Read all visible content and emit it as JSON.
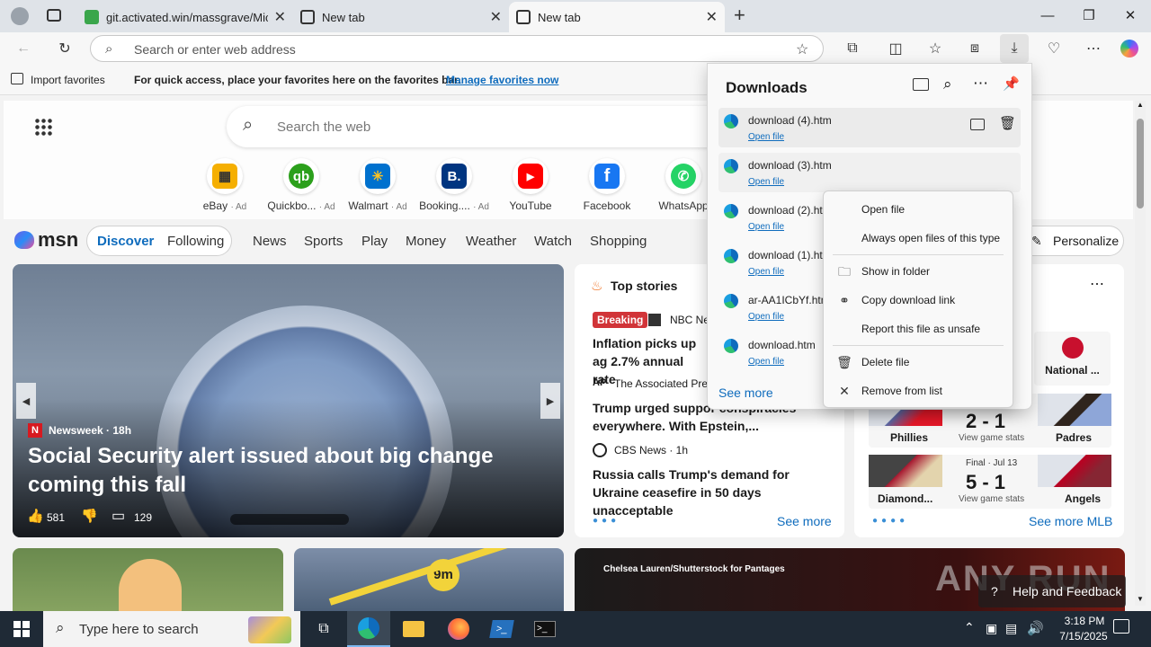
{
  "browser": {
    "tabs": [
      {
        "title": "git.activated.win/massgrave/Micr"
      },
      {
        "title": "New tab"
      },
      {
        "title": "New tab"
      }
    ],
    "address_placeholder": "Search or enter web address"
  },
  "favorites_bar": {
    "import": "Import favorites",
    "message": "For quick access, place your favorites here on the favorites bar.",
    "manage_link": "Manage favorites now"
  },
  "msn": {
    "search_placeholder": "Search the web",
    "quick_links": [
      {
        "label": "eBay",
        "ad": "· Ad"
      },
      {
        "label": "Quickbo...",
        "ad": "· Ad"
      },
      {
        "label": "Walmart",
        "ad": "· Ad"
      },
      {
        "label": "Booking....",
        "ad": "· Ad"
      },
      {
        "label": "YouTube",
        "ad": ""
      },
      {
        "label": "Facebook",
        "ad": ""
      },
      {
        "label": "WhatsApp",
        "ad": ""
      }
    ],
    "logo": "msn",
    "nav": [
      "Discover",
      "Following",
      "News",
      "Sports",
      "Play",
      "Money",
      "Weather",
      "Watch",
      "Shopping"
    ],
    "personalize": "Personalize",
    "hero": {
      "source": "Newsweek · 18h",
      "headline": "Social Security alert issued about big change coming this fall",
      "likes": "581",
      "comments": "129"
    },
    "top_stories": {
      "title": "Top stories",
      "breaking": "Breaking",
      "items": [
        {
          "source": "NBC Ne",
          "headline": "Inflation picks up ag 2.7% annual rate"
        },
        {
          "source": "The Associated Pres",
          "headline": "Trump urged suppor conspiracies everywhere. With Epstein,..."
        },
        {
          "source": "CBS News · 1h",
          "headline": "Russia calls Trump's demand for Ukraine ceasefire in 50 days unacceptable"
        }
      ],
      "see_more": "See more"
    },
    "sports": {
      "national": "National ...",
      "games": [
        {
          "team1": "Phillies",
          "score": "2 - 1",
          "team2": "Padres",
          "status": "View game stats",
          "final": ""
        },
        {
          "team1": "Diamond...",
          "score": "5 - 1",
          "team2": "Angels",
          "status": "View game stats",
          "final": "Final · Jul 13"
        }
      ],
      "see_more": "See more MLB"
    },
    "photo_credit": "Chelsea Lauren/Shutterstock for Pantages",
    "badge_9m": "9m",
    "help": "Help and Feedback"
  },
  "downloads": {
    "title": "Downloads",
    "items": [
      {
        "name": "download (4).htm",
        "open": "Open file"
      },
      {
        "name": "download (3).htm",
        "open": "Open file"
      },
      {
        "name": "download (2).ht",
        "open": "Open file"
      },
      {
        "name": "download (1).ht",
        "open": "Open file"
      },
      {
        "name": "ar-AA1ICbYf.htn",
        "open": "Open file"
      },
      {
        "name": "download.htm",
        "open": "Open file"
      }
    ],
    "see_more": "See more"
  },
  "context_menu": {
    "open_file": "Open file",
    "always_open": "Always open files of this type",
    "show_in_folder": "Show in folder",
    "copy_link": "Copy download link",
    "report": "Report this file as unsafe",
    "delete": "Delete file",
    "remove": "Remove from list"
  },
  "taskbar": {
    "search_placeholder": "Type here to search",
    "time": "3:18 PM",
    "date": "7/15/2025"
  },
  "watermark": "ANY RUN"
}
